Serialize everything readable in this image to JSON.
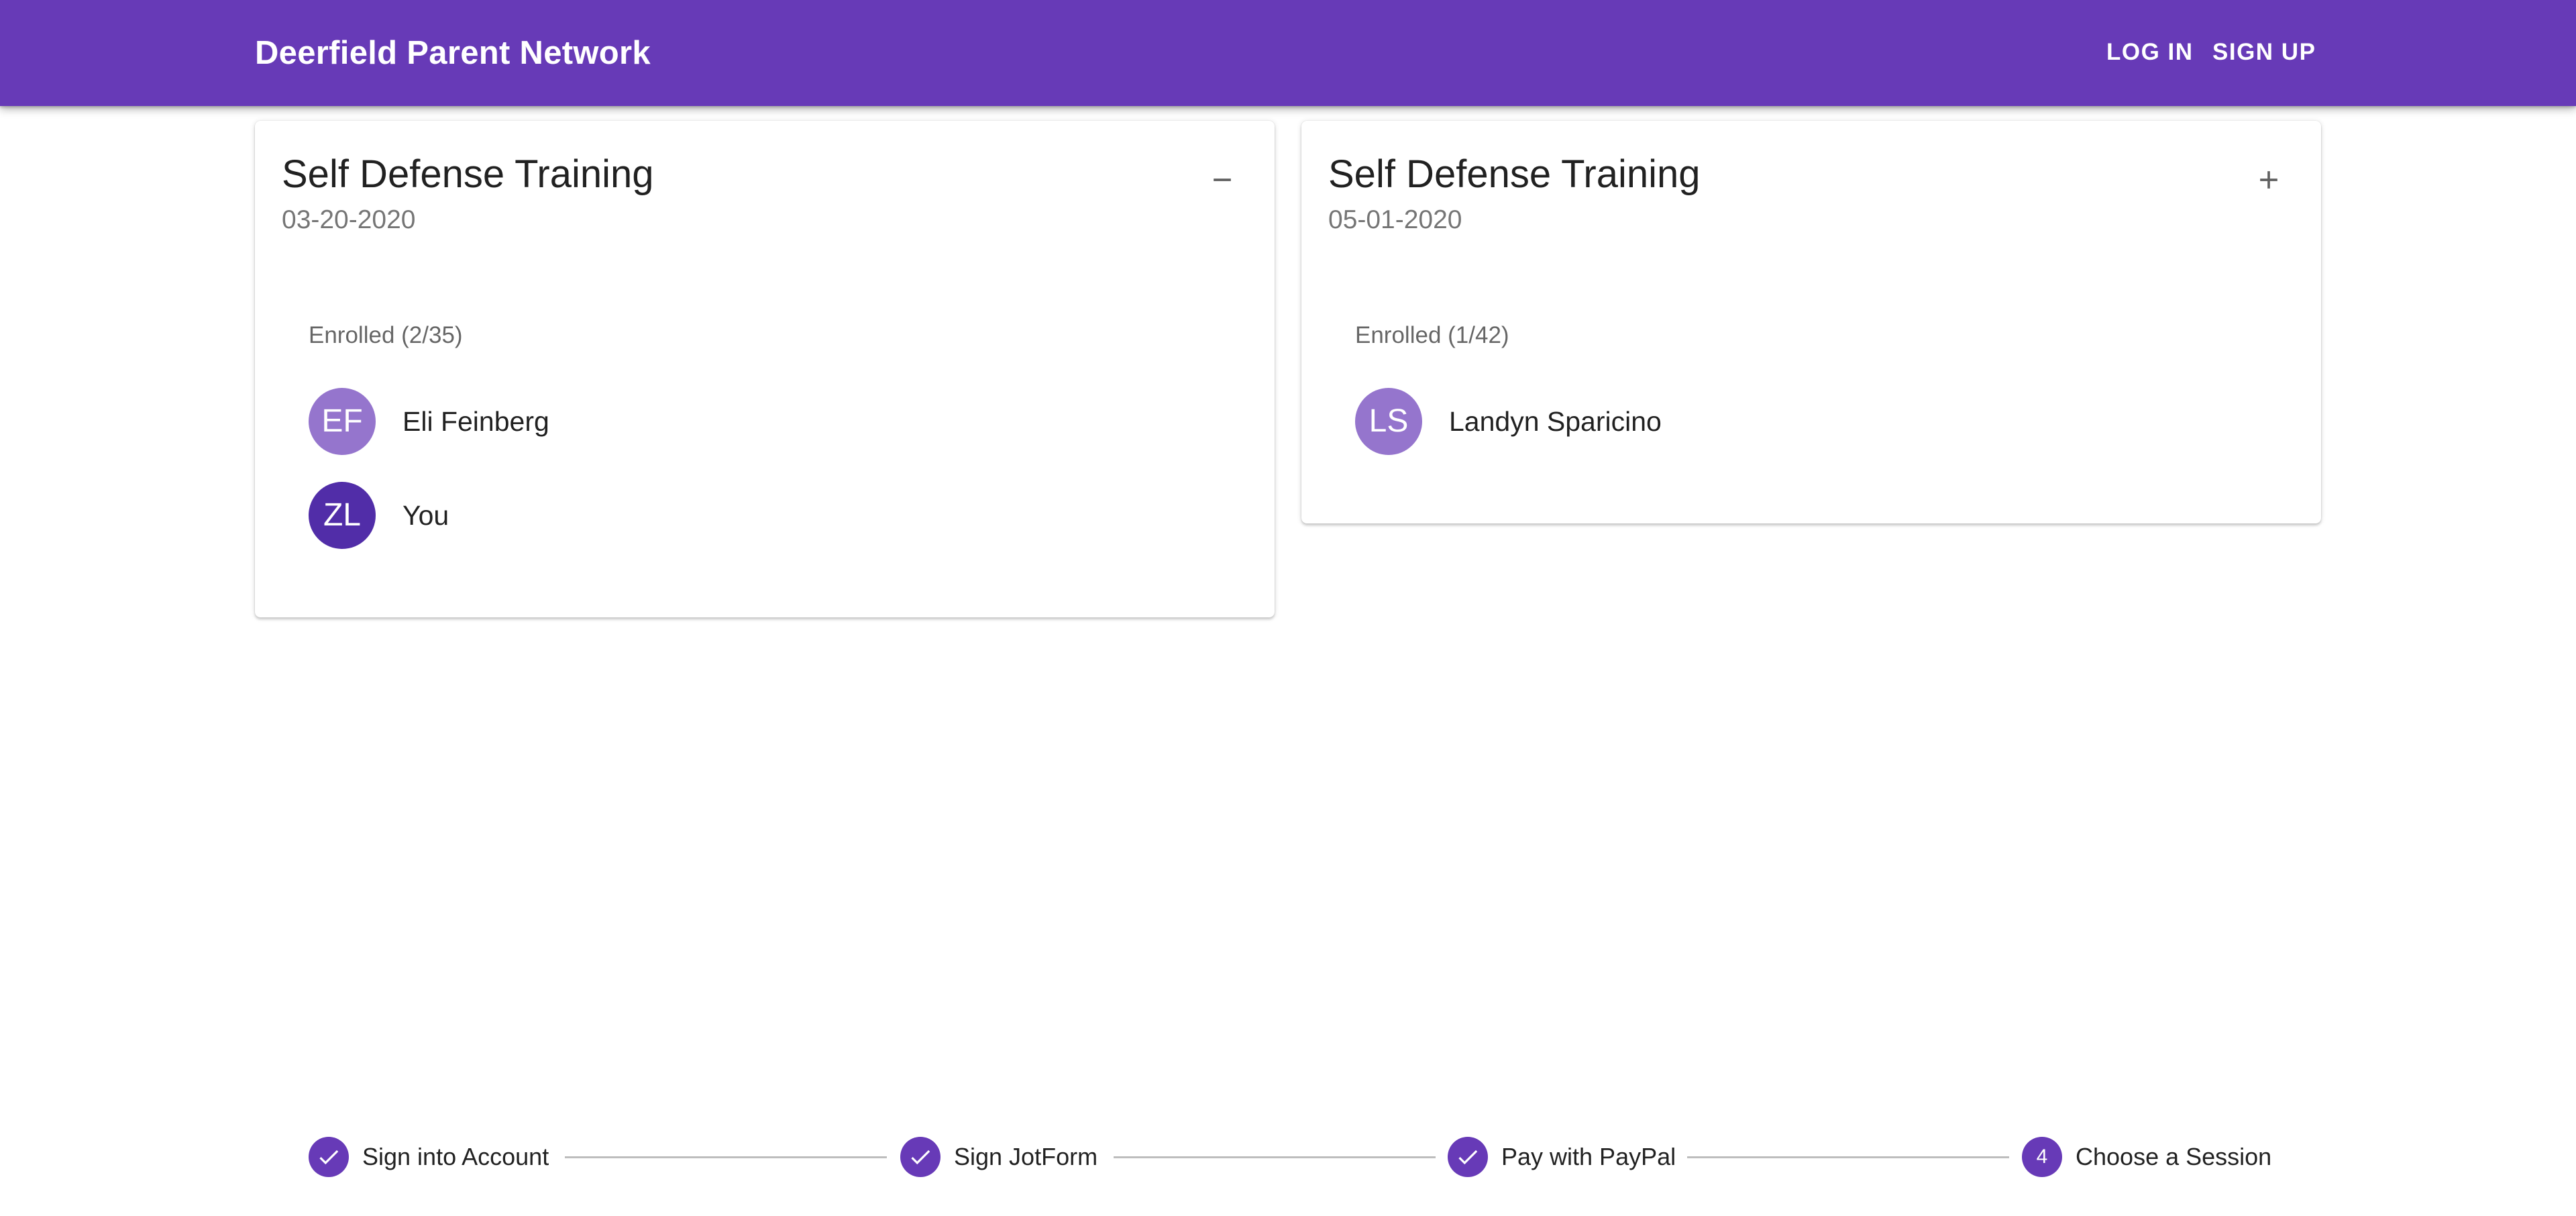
{
  "app": {
    "title": "Deerfield Parent Network",
    "accent_color": "#673ab7"
  },
  "nav": {
    "login_label": "LOG IN",
    "signup_label": "SIGN UP"
  },
  "sessions": [
    {
      "title": "Self Defense Training",
      "date": "03-20-2020",
      "expanded": true,
      "toggle_icon": "minus-icon",
      "enrolled_label": "Enrolled (2/35)",
      "members": [
        {
          "initials": "EF",
          "name": "Eli Feinberg",
          "avatar_color": "#9575cd"
        },
        {
          "initials": "ZL",
          "name": "You",
          "avatar_color": "#512da8"
        }
      ]
    },
    {
      "title": "Self Defense Training",
      "date": "05-01-2020",
      "expanded": false,
      "toggle_icon": "plus-icon",
      "enrolled_label": "Enrolled (1/42)",
      "members": [
        {
          "initials": "LS",
          "name": "Landyn Sparicino",
          "avatar_color": "#9575cd"
        }
      ]
    }
  ],
  "stepper": {
    "steps": [
      {
        "label": "Sign into Account",
        "completed": true,
        "icon": "check-icon"
      },
      {
        "label": "Sign JotForm",
        "completed": true,
        "icon": "check-icon"
      },
      {
        "label": "Pay with PayPal",
        "completed": true,
        "icon": "check-icon"
      },
      {
        "label": "Choose a Session",
        "completed": false,
        "number": "4"
      }
    ]
  }
}
